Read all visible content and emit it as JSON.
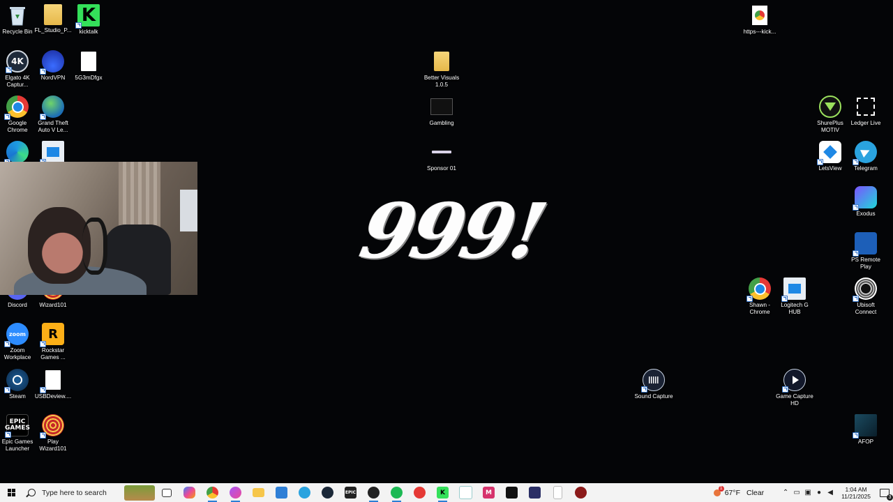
{
  "desktop": {
    "icons": [
      {
        "id": "recycle-bin",
        "label": "Recycle Bin",
        "icon": "recycle-bin-icon",
        "shortcut": false
      },
      {
        "id": "fl-studio",
        "label": "FL_Studio_P...",
        "icon": "folder-icon",
        "shortcut": false
      },
      {
        "id": "kicktalk",
        "label": "kicktalk",
        "icon": "kick-icon",
        "shortcut": true
      },
      {
        "id": "elgato",
        "label": "Elgato 4K Captur...",
        "icon": "elgato-4k-icon",
        "shortcut": true
      },
      {
        "id": "nordvpn",
        "label": "NordVPN",
        "icon": "nordvpn-icon",
        "shortcut": true
      },
      {
        "id": "file-5g3",
        "label": "5G3mDfgx",
        "icon": "file-icon",
        "shortcut": false
      },
      {
        "id": "chrome",
        "label": "Google Chrome",
        "icon": "chrome-icon",
        "shortcut": true
      },
      {
        "id": "gta",
        "label": "Grand Theft Auto V Le...",
        "icon": "globe-icon",
        "shortcut": true
      },
      {
        "id": "edge",
        "label": "",
        "icon": "edge-icon",
        "shortcut": true
      },
      {
        "id": "monitor-app",
        "label": "",
        "icon": "monitor-icon",
        "shortcut": true
      },
      {
        "id": "discord",
        "label": "Discord",
        "icon": "discord-icon",
        "shortcut": true
      },
      {
        "id": "wizard101",
        "label": "Wizard101",
        "icon": "wizard101-icon",
        "shortcut": true
      },
      {
        "id": "zoom",
        "label": "Zoom Workplace",
        "icon": "zoom-icon",
        "shortcut": true
      },
      {
        "id": "rockstar",
        "label": "Rockstar Games ...",
        "icon": "rockstar-icon",
        "shortcut": true
      },
      {
        "id": "steam",
        "label": "Steam",
        "icon": "steam-icon",
        "shortcut": true
      },
      {
        "id": "usbdeview",
        "label": "USBDeview....",
        "icon": "file-icon",
        "shortcut": true
      },
      {
        "id": "epic",
        "label": "Epic Games Launcher",
        "icon": "epic-icon",
        "shortcut": true
      },
      {
        "id": "play-wizard",
        "label": "Play Wizard101",
        "icon": "wizard101-icon",
        "shortcut": true
      },
      {
        "id": "better-visuals",
        "label": "Better Visuals 1.0.5",
        "icon": "folder-icon",
        "shortcut": false
      },
      {
        "id": "gambling",
        "label": "Gambling",
        "icon": "image-file-icon",
        "shortcut": false
      },
      {
        "id": "sponsor",
        "label": "Sponsor 01",
        "icon": "image-file-icon",
        "shortcut": false
      },
      {
        "id": "https-kick",
        "label": "https---kick...",
        "icon": "chrome-file-icon",
        "shortcut": false
      },
      {
        "id": "shureplus",
        "label": "ShurePlus MOTIV",
        "icon": "shure-icon",
        "shortcut": false
      },
      {
        "id": "ledger",
        "label": "Ledger Live",
        "icon": "ledger-icon",
        "shortcut": false
      },
      {
        "id": "letsview",
        "label": "LetsView",
        "icon": "letsview-icon",
        "shortcut": true
      },
      {
        "id": "telegram",
        "label": "Telegram",
        "icon": "telegram-icon",
        "shortcut": true
      },
      {
        "id": "exodus",
        "label": "Exodus",
        "icon": "exodus-icon",
        "shortcut": true
      },
      {
        "id": "ps-remote",
        "label": "PS Remote Play",
        "icon": "ps-remote-icon",
        "shortcut": true
      },
      {
        "id": "shawn-chrome",
        "label": "Shawn - Chrome",
        "icon": "chrome-icon",
        "shortcut": true
      },
      {
        "id": "logitech",
        "label": "Logitech G HUB",
        "icon": "monitor-icon",
        "shortcut": true
      },
      {
        "id": "ubisoft",
        "label": "Ubisoft Connect",
        "icon": "ubisoft-icon",
        "shortcut": true
      },
      {
        "id": "sound-capture",
        "label": "Sound Capture",
        "icon": "sound-capture-icon",
        "shortcut": true
      },
      {
        "id": "game-capture",
        "label": "Game Capture HD",
        "icon": "game-capture-icon",
        "shortcut": true
      },
      {
        "id": "afop",
        "label": "AFOP",
        "icon": "afop-icon",
        "shortcut": true
      }
    ]
  },
  "wallpaper": {
    "text": "999!"
  },
  "taskbar": {
    "search_placeholder": "Type here to search",
    "apps": [
      "task-view-icon",
      "copilot-icon",
      "chrome-icon",
      "messenger-icon",
      "file-explorer-icon",
      "store-icon",
      "telegram-icon",
      "steam-icon",
      "epic-icon",
      "obs-icon",
      "spotify-icon",
      "app-red-icon",
      "kick-icon",
      "letsview-icon",
      "canva-icon",
      "terminal-icon",
      "exodus-icon",
      "blank-icon",
      "record-icon"
    ],
    "weather": {
      "temp": "67°F",
      "condition": "Clear"
    },
    "clock": {
      "time": "1:04 AM",
      "date": "11/21/2025"
    }
  }
}
